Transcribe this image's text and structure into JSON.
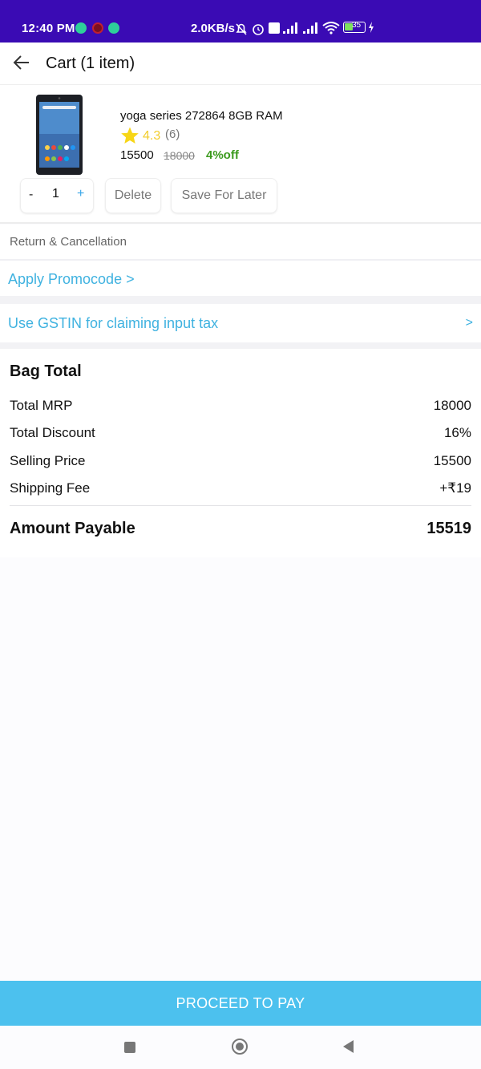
{
  "status_bar": {
    "time": "12:40 PM",
    "net_speed": "2.0KB/s",
    "battery": "35"
  },
  "header": {
    "title": "Cart (1 item)",
    "back_icon": "arrow-left-icon"
  },
  "cart_item": {
    "name": "yoga series 272864 8GB RAM",
    "rating": "4.3",
    "rating_count": "(6)",
    "price": "15500",
    "mrp": "18000",
    "discount": "4%off",
    "quantity": "1",
    "qty_minus": "-",
    "qty_plus": "+",
    "delete_label": "Delete",
    "save_later_label": "Save For Later"
  },
  "return_cancellation": "Return & Cancellation",
  "promo": {
    "label": "Apply Promocode >"
  },
  "gstin": {
    "label": "Use GSTIN for claiming input tax",
    "chevron": ">"
  },
  "bag": {
    "title": "Bag Total",
    "rows": [
      {
        "label": "Total MRP",
        "value": "18000"
      },
      {
        "label": "Total Discount",
        "value": "16%"
      },
      {
        "label": "Selling Price",
        "value": "15500"
      },
      {
        "label": "Shipping Fee",
        "value": "+₹19"
      }
    ],
    "payable_label": "Amount Payable",
    "payable_value": "15519"
  },
  "proceed_label": "PROCEED TO PAY",
  "colors": {
    "accent": "#4cc1ee",
    "link": "#3fb2e0",
    "status_bar": "#3a0bb4",
    "discount": "#3b9a1d",
    "star": "#f2cd2d"
  }
}
